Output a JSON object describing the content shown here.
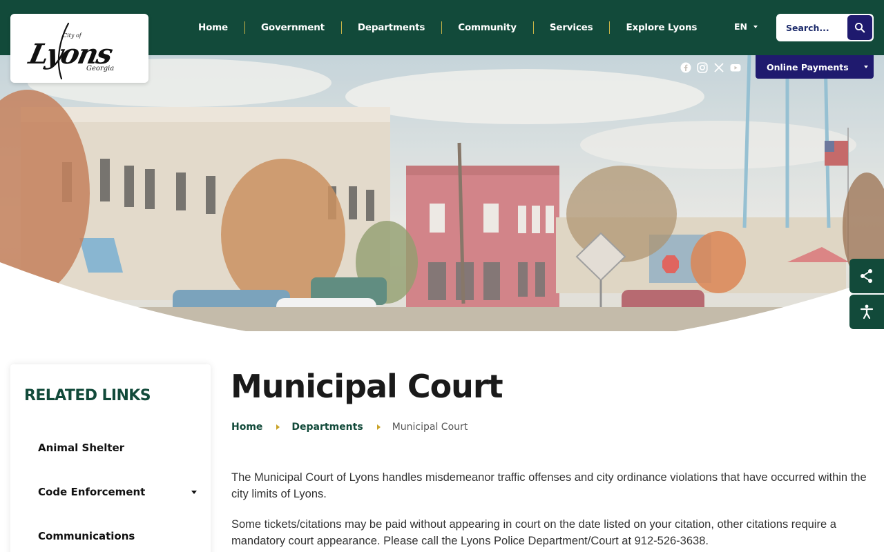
{
  "logo": {
    "city_of": "City of",
    "name": "Lyons",
    "state": "Georgia"
  },
  "nav": {
    "items": [
      "Home",
      "Government",
      "Departments",
      "Community",
      "Services",
      "Explore Lyons"
    ]
  },
  "language": {
    "selected": "EN"
  },
  "search": {
    "placeholder": "Search..."
  },
  "social": [
    "facebook-icon",
    "instagram-icon",
    "x-icon",
    "youtube-icon"
  ],
  "payments": {
    "label": "Online Payments"
  },
  "related_links": {
    "title": "RELATED LINKS",
    "items": [
      {
        "label": "Animal Shelter",
        "has_submenu": false
      },
      {
        "label": "Code Enforcement",
        "has_submenu": true
      },
      {
        "label": "Communications",
        "has_submenu": false
      }
    ]
  },
  "page": {
    "title": "Municipal Court",
    "breadcrumb": [
      "Home",
      "Departments",
      "Municipal Court"
    ],
    "paragraphs": [
      "The Municipal Court of Lyons handles misdemeanor traffic offenses and city ordinance violations that have occurred within the city limits of Lyons.",
      "Some tickets/citations may be paid without appearing in court on the date listed on your citation, other citations require a mandatory court appearance. Please call the Lyons Police Department/Court at 912-526-3638."
    ]
  },
  "colors": {
    "primary_green": "#124a3a",
    "navy": "#1f1a6e",
    "gold_accent": "#c9b547"
  }
}
